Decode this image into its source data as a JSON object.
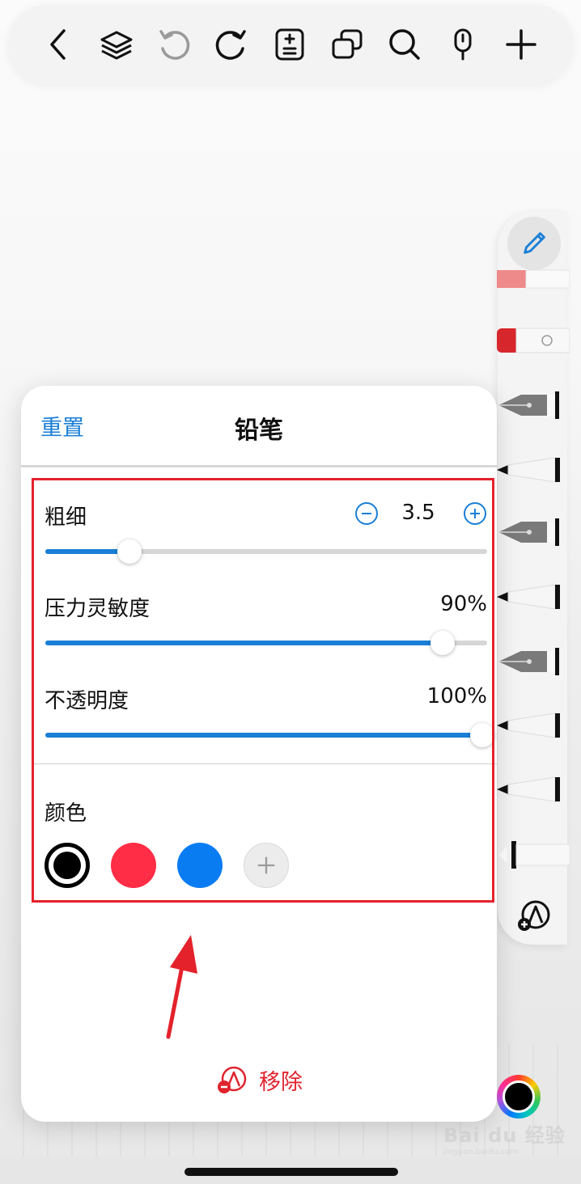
{
  "toolbar": {
    "icons": [
      "chevron-left-icon",
      "layers-icon",
      "undo-icon",
      "redo-icon",
      "page-add-icon",
      "copy-pages-icon",
      "search-icon",
      "microphone-icon",
      "plus-icon"
    ]
  },
  "panel": {
    "reset_label": "重置",
    "title": "铅笔",
    "thickness": {
      "label": "粗细",
      "value": "3.5",
      "fraction": 0.19
    },
    "pressure": {
      "label": "压力灵敏度",
      "value": "90%",
      "fraction": 0.9
    },
    "opacity": {
      "label": "不透明度",
      "value": "100%",
      "fraction": 1.0
    },
    "color_label": "颜色",
    "colors": [
      {
        "name": "black",
        "hex": "#000000",
        "selected": true
      },
      {
        "name": "red",
        "hex": "#ff2d45",
        "selected": false
      },
      {
        "name": "blue",
        "hex": "#0a7cf2",
        "selected": false
      }
    ],
    "remove_label": "移除"
  },
  "accent_color": "#1a7fd6",
  "annotation_color": "#e4222b",
  "watermark": {
    "text": "Bai du 经验",
    "sub": "jingyan.baidu.com"
  }
}
